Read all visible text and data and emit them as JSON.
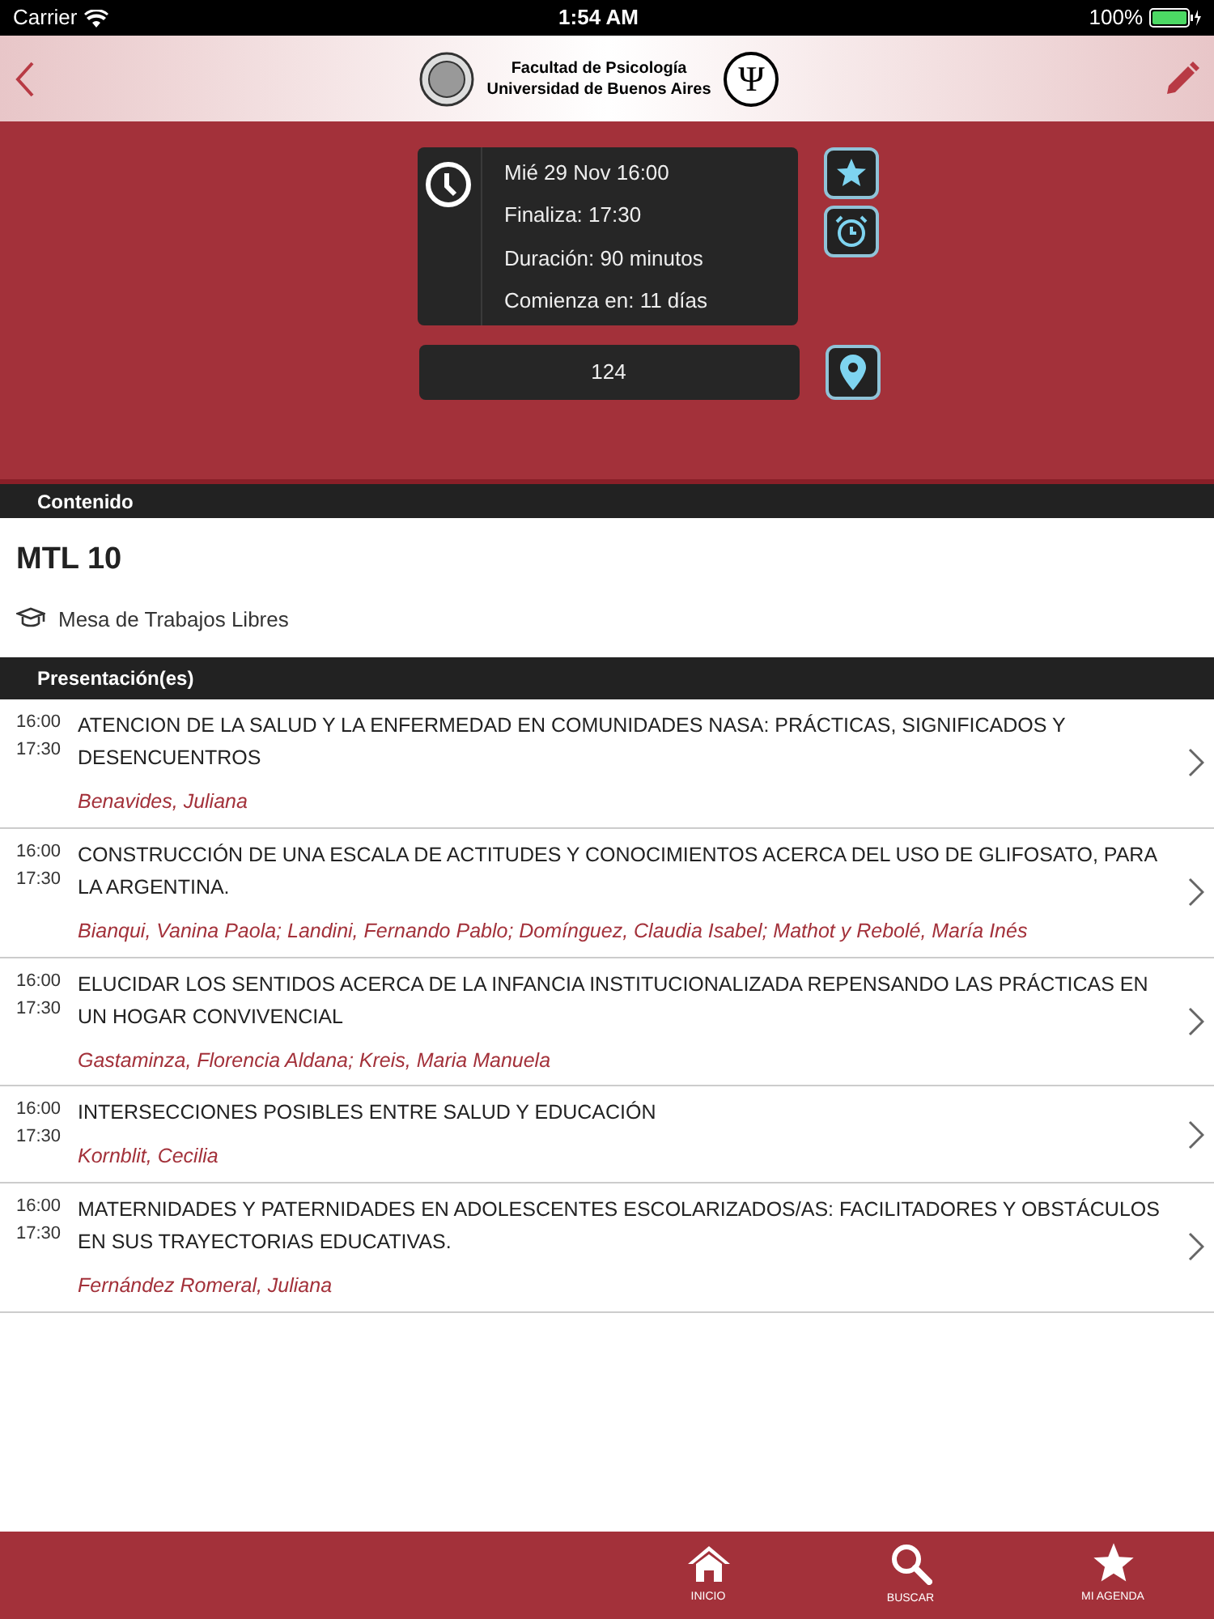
{
  "status_bar": {
    "carrier": "Carrier",
    "time": "1:54 AM",
    "battery": "100%"
  },
  "header": {
    "logo_line_1": "Facultad de Psicología",
    "logo_line_2": "Universidad de Buenos Aires",
    "logo_symbol": "Ψ"
  },
  "schedule": {
    "start": "Mié 29  Nov  16:00",
    "end": "Finaliza: 17:30",
    "duration": "Duración: 90 minutos",
    "starts_in": "Comienza en: 11 días",
    "room": "124"
  },
  "content_header": "Contenido",
  "session": {
    "code": "MTL 10",
    "type": "Mesa de Trabajos Libres"
  },
  "presentations_header": "Presentación(es)",
  "presentations": [
    {
      "start": "16:00",
      "end": "17:30",
      "title": "ATENCION DE LA SALUD Y LA ENFERMEDAD EN COMUNIDADES NASA: PRÁCTICAS, SIGNIFICADOS Y DESENCUENTROS",
      "authors": "Benavides, Juliana"
    },
    {
      "start": "16:00",
      "end": "17:30",
      "title": "CONSTRUCCIÓN DE UNA ESCALA DE ACTITUDES Y CONOCIMIENTOS ACERCA DEL USO DE GLIFOSATO, PARA LA ARGENTINA.",
      "authors": "Bianqui, Vanina Paola; Landini, Fernando Pablo; Domínguez, Claudia Isabel; Mathot y Rebolé, María Inés"
    },
    {
      "start": "16:00",
      "end": "17:30",
      "title": "ELUCIDAR LOS SENTIDOS ACERCA DE LA INFANCIA INSTITUCIONALIZADA REPENSANDO LAS PRÁCTICAS EN UN HOGAR CONVIVENCIAL",
      "authors": "Gastaminza, Florencia Aldana; Kreis, Maria Manuela"
    },
    {
      "start": "16:00",
      "end": "17:30",
      "title": "INTERSECCIONES POSIBLES ENTRE SALUD Y EDUCACIÓN",
      "authors": "Kornblit, Cecilia"
    },
    {
      "start": "16:00",
      "end": "17:30",
      "title": "MATERNIDADES Y PATERNIDADES EN ADOLESCENTES ESCOLARIZADOS/AS: FACILITADORES Y OBSTÁCULOS EN SUS TRAYECTORIAS EDUCATIVAS.",
      "authors": "Fernández Romeral, Juliana"
    }
  ],
  "tab_bar": [
    {
      "kind": "home",
      "label": "INICIO"
    },
    {
      "kind": "search",
      "label": "BUSCAR"
    },
    {
      "kind": "star",
      "label": "MI AGENDA"
    }
  ]
}
